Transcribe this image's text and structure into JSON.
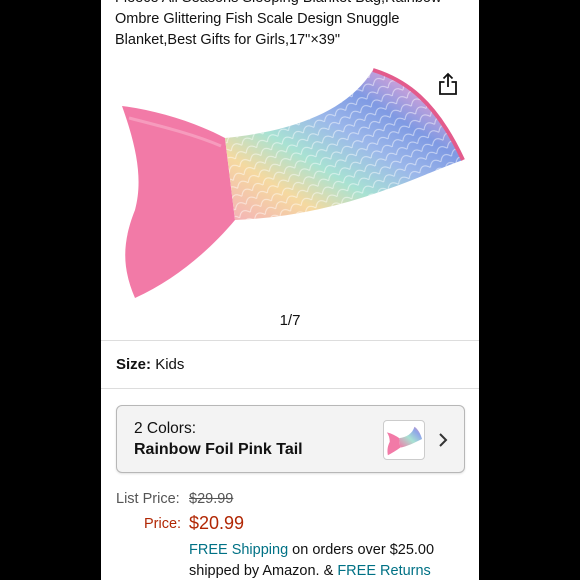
{
  "product": {
    "title_lines": [
      "Fleece All Seasons Sleeping Blanket Bag,Rainbow",
      "Ombre Glittering Fish Scale Design Snuggle",
      "Blanket,Best Gifts for Girls,17\"×39\""
    ]
  },
  "gallery": {
    "counter": "1/7",
    "image_icon": "mermaid-tail-blanket-image"
  },
  "size": {
    "label": "Size:",
    "value": "Kids"
  },
  "colors": {
    "count_label": "2 Colors:",
    "selected": "Rainbow Foil Pink Tail",
    "chevron_icon": "chevron-right-icon"
  },
  "pricing": {
    "list_price_label": "List Price:",
    "list_price": "$29.99",
    "price_label": "Price:",
    "price": "$20.99",
    "price_color": "#B12704"
  },
  "shipping": {
    "free_shipping": "FREE Shipping",
    "middle_text": " on orders over $25.00",
    "line2_prefix": "shipped by Amazon. & ",
    "free_returns": "FREE Returns",
    "link_color": "#007185"
  }
}
